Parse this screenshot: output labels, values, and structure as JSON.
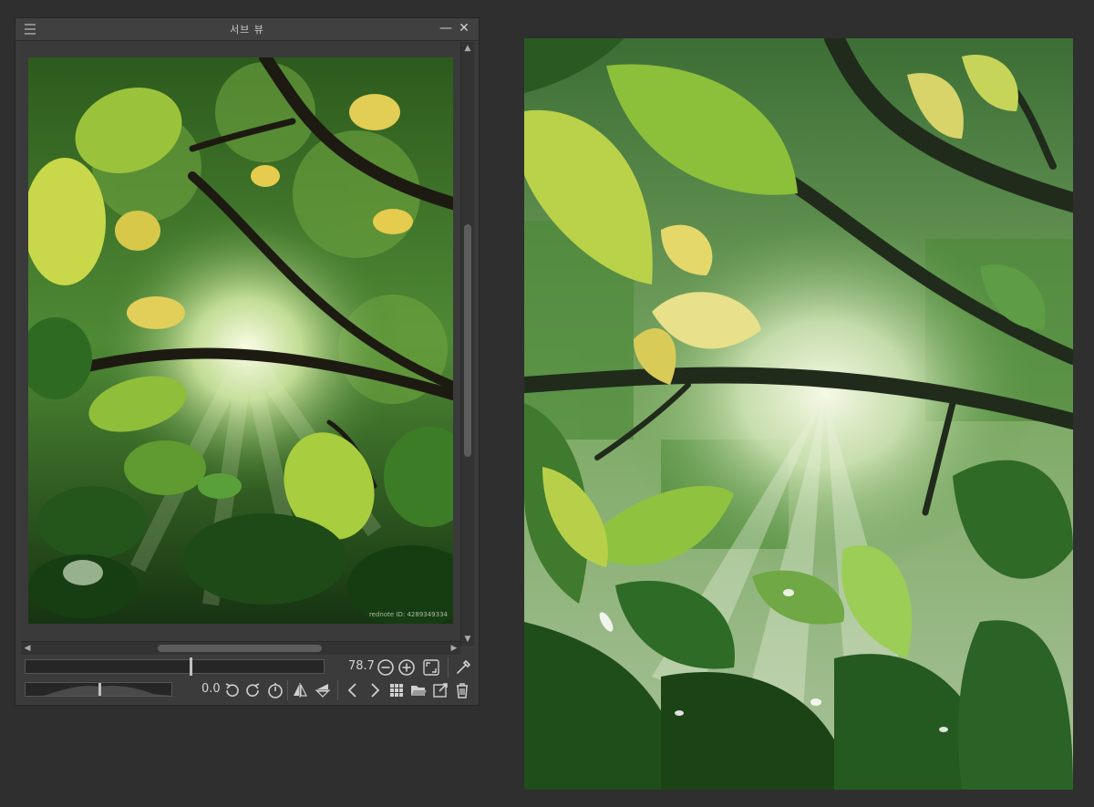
{
  "subview": {
    "title": "서브 뷰",
    "watermark": "rednote ID: 4289349334",
    "zoom_value": "78.7",
    "rotation_value": "0.0"
  },
  "colors": {
    "panel_bg": "#3b3b3b",
    "app_bg": "#2f2f2f",
    "leaf_light": "#c8d84a",
    "leaf_dark": "#1f4a1c",
    "sunlight": "#f4f8e0"
  },
  "icons": [
    "menu-icon",
    "minimize-icon",
    "close-icon",
    "zoom-out-icon",
    "zoom-in-icon",
    "fit-window-icon",
    "eyedropper-icon",
    "rotate-left-icon",
    "rotate-right-icon",
    "reset-rotation-icon",
    "flip-horizontal-icon",
    "flip-vertical-icon",
    "previous-icon",
    "next-icon",
    "grid-view-icon",
    "open-folder-icon",
    "import-image-icon",
    "delete-icon"
  ]
}
